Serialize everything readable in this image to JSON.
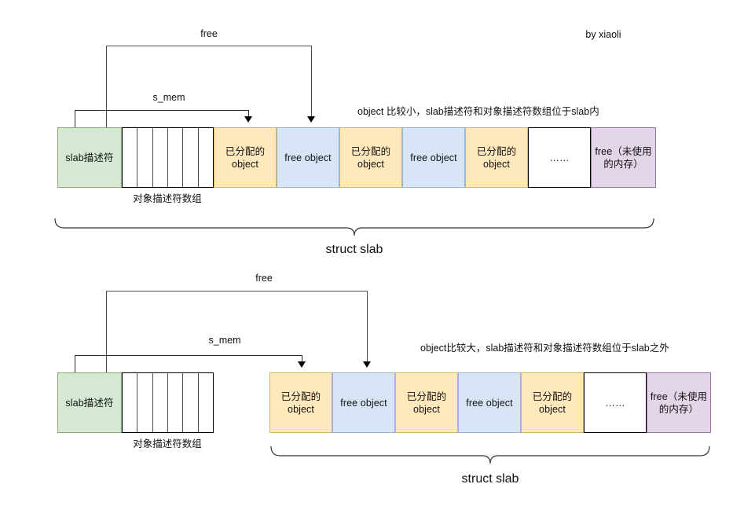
{
  "diagram": {
    "credit": "by xiaoli",
    "colors": {
      "slab_descriptor": "#d5e8d4",
      "allocated_object": "#ffe8bb",
      "free_object": "#d7e5f7",
      "free_memory": "#e1d5e7",
      "ellipsis_block": "#ffffff",
      "connector": "#4d4d4d"
    },
    "sections": [
      {
        "id": "small-object-slab",
        "annotation": "object 比较小，slab描述符和对象描述符数组位于slab内",
        "pointers": [
          {
            "name": "free-pointer",
            "label": "free"
          },
          {
            "name": "s-mem-pointer",
            "label": "s_mem"
          }
        ],
        "array_label": "对象描述符数组",
        "array_cells": 6,
        "bracket_label": "struct slab",
        "blocks": [
          {
            "name": "slab-descriptor",
            "kind": "green",
            "text": "slab描述符"
          },
          {
            "name": "allocated-object-1",
            "kind": "orange",
            "text": "已分配的\nobject"
          },
          {
            "name": "free-object-1",
            "kind": "blue",
            "text": "free object"
          },
          {
            "name": "allocated-object-2",
            "kind": "orange",
            "text": "已分配的\nobject"
          },
          {
            "name": "free-object-2",
            "kind": "blue",
            "text": "free object"
          },
          {
            "name": "allocated-object-3",
            "kind": "orange",
            "text": "已分配的\nobject"
          },
          {
            "name": "ellipsis-block",
            "kind": "white",
            "text": "……"
          },
          {
            "name": "free-memory",
            "kind": "purple",
            "text": "free（未使用\n的内存）"
          }
        ]
      },
      {
        "id": "large-object-slab",
        "annotation": "object比较大，slab描述符和对象描述符数组位于slab之外",
        "pointers": [
          {
            "name": "free-pointer",
            "label": "free"
          },
          {
            "name": "s-mem-pointer",
            "label": "s_mem"
          }
        ],
        "array_label": "对象描述符数组",
        "array_cells": 6,
        "bracket_label": "struct slab",
        "blocks": [
          {
            "name": "slab-descriptor",
            "kind": "green",
            "text": "slab描述符"
          },
          {
            "name": "allocated-object-1",
            "kind": "orange",
            "text": "已分配的\nobject"
          },
          {
            "name": "free-object-1",
            "kind": "blue",
            "text": "free object"
          },
          {
            "name": "allocated-object-2",
            "kind": "orange",
            "text": "已分配的\nobject"
          },
          {
            "name": "free-object-2",
            "kind": "blue",
            "text": "free object"
          },
          {
            "name": "allocated-object-3",
            "kind": "orange",
            "text": "已分配的\nobject"
          },
          {
            "name": "ellipsis-block",
            "kind": "white",
            "text": "……"
          },
          {
            "name": "free-memory",
            "kind": "purple",
            "text": "free（未使用\n的内存）"
          }
        ]
      }
    ]
  }
}
